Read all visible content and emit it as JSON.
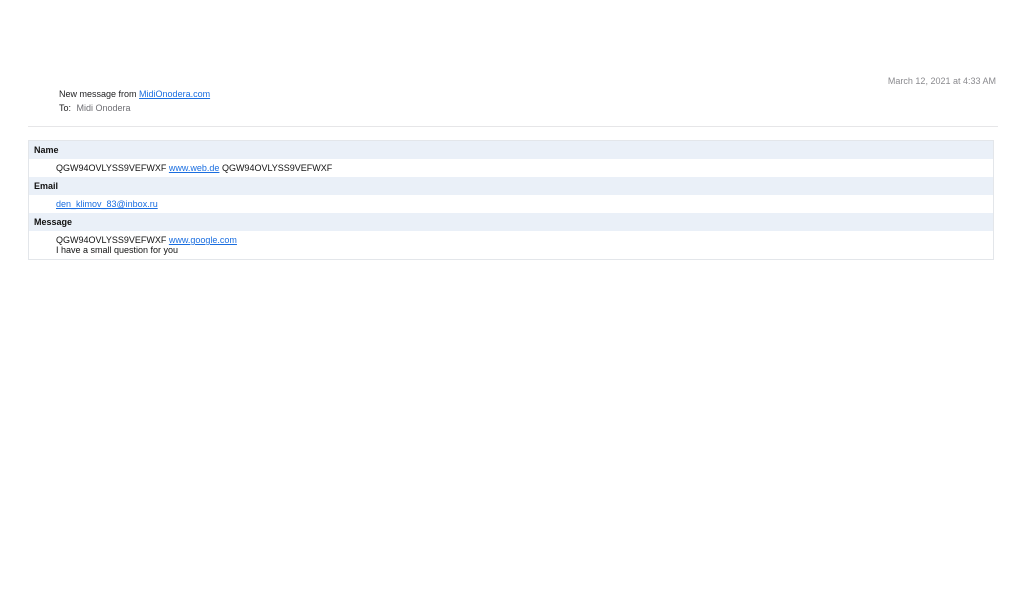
{
  "header": {
    "date": "March 12, 2021 at 4:33 AM",
    "subject_prefix": "New message from",
    "subject_link": "MidiOnodera.com",
    "to_label": "To:",
    "to_value": "Midi Onodera"
  },
  "fields": {
    "name": {
      "label": "Name",
      "value_pre": "QGW94OVLYSS9VEFWXF",
      "value_link": "www.web.de",
      "value_post": "QGW94OVLYSS9VEFWXF"
    },
    "email": {
      "label": "Email",
      "value_link": "den_klimov_83@inbox.ru"
    },
    "message": {
      "label": "Message",
      "line1_pre": "QGW94OVLYSS9VEFWXF",
      "line1_link": "www.google.com",
      "line2": "I have a small question for you"
    }
  },
  "colors": {
    "link": "#1a6ee0",
    "label_background": "#eaf0f8",
    "muted_text": "#8a8a8e"
  }
}
